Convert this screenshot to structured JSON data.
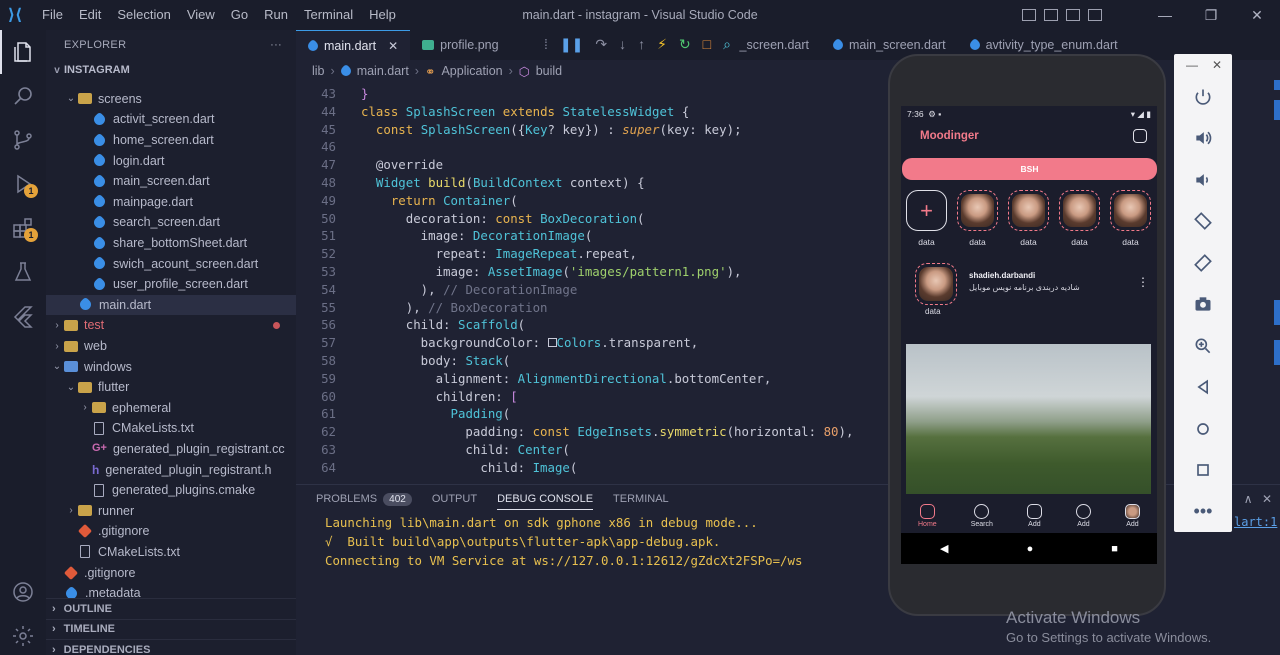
{
  "window": {
    "title": "main.dart - instagram - Visual Studio Code",
    "menu": [
      "File",
      "Edit",
      "Selection",
      "View",
      "Go",
      "Run",
      "Terminal",
      "Help"
    ]
  },
  "activity_bar": {
    "items": [
      {
        "name": "explorer-icon"
      },
      {
        "name": "search-icon"
      },
      {
        "name": "source-control-icon"
      },
      {
        "name": "run-debug-icon",
        "badge": "1"
      },
      {
        "name": "extensions-icon",
        "badge": "1"
      },
      {
        "name": "testing-icon"
      },
      {
        "name": "flutter-icon"
      },
      {
        "name": "account-icon"
      },
      {
        "name": "settings-gear-icon"
      }
    ]
  },
  "explorer": {
    "header": "EXPLORER",
    "root": "INSTAGRAM",
    "rows": [
      {
        "label": "screens",
        "type": "folder",
        "indent": 1,
        "chev": "v"
      },
      {
        "label": "activit_screen.dart",
        "type": "dart",
        "indent": 2
      },
      {
        "label": "home_screen.dart",
        "type": "dart",
        "indent": 2
      },
      {
        "label": "login.dart",
        "type": "dart",
        "indent": 2
      },
      {
        "label": "main_screen.dart",
        "type": "dart",
        "indent": 2
      },
      {
        "label": "mainpage.dart",
        "type": "dart",
        "indent": 2
      },
      {
        "label": "search_screen.dart",
        "type": "dart",
        "indent": 2
      },
      {
        "label": "share_bottomSheet.dart",
        "type": "dart",
        "indent": 2
      },
      {
        "label": "swich_acount_screen.dart",
        "type": "dart",
        "indent": 2
      },
      {
        "label": "user_profile_screen.dart",
        "type": "dart",
        "indent": 2
      },
      {
        "label": "main.dart",
        "type": "dart",
        "indent": 1,
        "selected": true
      },
      {
        "label": "test",
        "type": "folder-red",
        "indent": 0,
        "chev": ">",
        "red": true,
        "dot": true
      },
      {
        "label": "web",
        "type": "folder",
        "indent": 0,
        "chev": ">"
      },
      {
        "label": "windows",
        "type": "folder-blue",
        "indent": 0,
        "chev": "v"
      },
      {
        "label": "flutter",
        "type": "folder",
        "indent": 1,
        "chev": "v"
      },
      {
        "label": "ephemeral",
        "type": "folder",
        "indent": 2,
        "chev": ">"
      },
      {
        "label": "CMakeLists.txt",
        "type": "txt",
        "indent": 2
      },
      {
        "label": "generated_plugin_registrant.cc",
        "type": "cc",
        "indent": 2
      },
      {
        "label": "generated_plugin_registrant.h",
        "type": "h",
        "indent": 2
      },
      {
        "label": "generated_plugins.cmake",
        "type": "txt",
        "indent": 2
      },
      {
        "label": "runner",
        "type": "folder",
        "indent": 1,
        "chev": ">"
      },
      {
        "label": ".gitignore",
        "type": "git",
        "indent": 1
      },
      {
        "label": "CMakeLists.txt",
        "type": "txt",
        "indent": 1
      },
      {
        "label": ".gitignore",
        "type": "git",
        "indent": 0
      },
      {
        "label": ".metadata",
        "type": "flutter",
        "indent": 0
      }
    ],
    "sections": [
      "OUTLINE",
      "TIMELINE",
      "DEPENDENCIES"
    ]
  },
  "tabs": [
    {
      "label": "main.dart",
      "active": true,
      "icon": "dart"
    },
    {
      "label": "profile.png",
      "icon": "image"
    },
    {
      "label": "e_screen.dart",
      "icon": "dart"
    },
    {
      "label": "main_screen.dart",
      "icon": "dart"
    },
    {
      "label": "avtivity_type_enum.dart",
      "icon": "dart"
    }
  ],
  "breadcrumb": [
    "lib",
    "main.dart",
    "Application",
    "build"
  ],
  "code_lines": [
    {
      "n": "43",
      "html": "<span class='brk'>}</span>"
    },
    {
      "n": "44",
      "html": "<span class='kw'>class</span> <span class='cls'>SplashScreen</span> <span class='kw'>extends</span> <span class='cls'>StatelessWidget</span> {"
    },
    {
      "n": "45",
      "html": "  <span class='kw'>const</span> <span class='cls'>SplashScreen</span>({<span class='cls'>Key</span>? key}) : <span class='it'>super</span>(key: key);"
    },
    {
      "n": "46",
      "html": ""
    },
    {
      "n": "47",
      "html": "  <span class='ann'>@override</span>"
    },
    {
      "n": "48",
      "html": "  <span class='cls'>Widget</span> <span class='fn'>build</span>(<span class='cls'>BuildContext</span> context) {"
    },
    {
      "n": "49",
      "html": "    <span class='kw'>return</span> <span class='cls'>Container</span>("
    },
    {
      "n": "50",
      "html": "      decoration: <span class='kw'>const</span> <span class='cls'>BoxDecoration</span>("
    },
    {
      "n": "51",
      "html": "        image: <span class='cls'>DecorationImage</span>("
    },
    {
      "n": "52",
      "html": "          repeat: <span class='cls'>ImageRepeat</span>.repeat,"
    },
    {
      "n": "53",
      "html": "          image: <span class='cls'>AssetImage</span>(<span class='str'>'images/pattern1.png'</span>),"
    },
    {
      "n": "54",
      "html": "        ), <span class='cm'>// DecorationImage</span>"
    },
    {
      "n": "55",
      "html": "      ), <span class='cm'>// BoxDecoration</span>"
    },
    {
      "n": "56",
      "html": "      child: <span class='cls'>Scaffold</span>("
    },
    {
      "n": "57",
      "html": "        backgroundColor: <span style='border:1px solid #c8cad8;display:inline-block;width:9px;height:9px;'></span><span class='cls'>Colors</span>.transparent,"
    },
    {
      "n": "58",
      "html": "        body: <span class='cls'>Stack</span>("
    },
    {
      "n": "59",
      "html": "          alignment: <span class='cls'>AlignmentDirectional</span>.bottomCenter,"
    },
    {
      "n": "60",
      "html": "          children: <span class='brk'>[</span>"
    },
    {
      "n": "61",
      "html": "            <span class='cls'>Padding</span>("
    },
    {
      "n": "62",
      "html": "              padding: <span class='kw'>const</span> <span class='cls'>EdgeInsets</span>.<span class='fn'>symmetric</span>(horizontal: <span class='num'>80</span>),"
    },
    {
      "n": "63",
      "html": "              child: <span class='cls'>Center</span>("
    },
    {
      "n": "64",
      "html": "                child: <span class='cls'>Image</span>("
    }
  ],
  "panel": {
    "tabs": [
      "PROBLEMS",
      "OUTPUT",
      "DEBUG CONSOLE",
      "TERMINAL"
    ],
    "problems_count": "402",
    "console": [
      "Launching lib\\main.dart on sdk gphone x86 in debug mode...",
      "√  Built build\\app\\outputs\\flutter-apk\\app-debug.apk.",
      "Connecting to VM Service at ws://127.0.0.1:12612/gZdcXt2FSPo=/ws"
    ],
    "line_ref": "lart:1"
  },
  "phone": {
    "time": "7:36",
    "app_title": "Moodinger",
    "button": "BSH",
    "stories": [
      "data",
      "data",
      "data",
      "data",
      "data"
    ],
    "post_user": "shadieh.darbandi",
    "post_desc": "شادیه دربندی برنامه نویس موبایل",
    "post_avatar_label": "data",
    "nav": [
      "Home",
      "Search",
      "Add",
      "Add",
      "Add"
    ]
  },
  "watermark": {
    "title": "Activate Windows",
    "subtitle": "Go to Settings to activate Windows."
  }
}
